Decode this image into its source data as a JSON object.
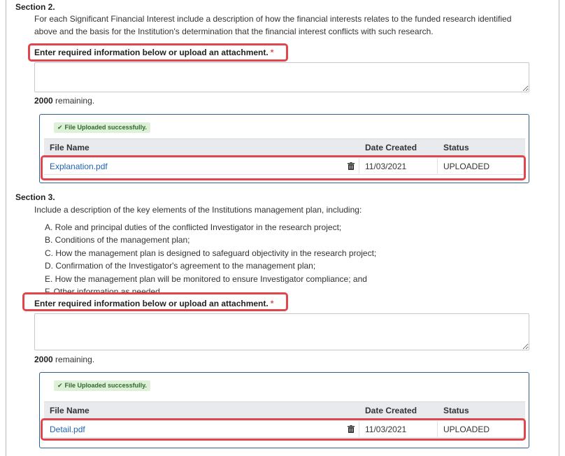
{
  "section2": {
    "title": "Section 2.",
    "description_line1": "For each Significant Financial Interest include a description of how the financial interests relates to the funded research identified",
    "description_line2": "above and the basis for the Institution's determination that the financial interest conflicts with such research.",
    "required_label": "Enter required information below or upload an attachment.",
    "required_marker": "*",
    "textarea_value": "",
    "remaining_count": "2000",
    "remaining_text": "remaining.",
    "upload_status": "File Uploaded successfully.",
    "table": {
      "headers": [
        "File Name",
        "Date Created",
        "Status"
      ],
      "rows": [
        {
          "file_name": "Explanation.pdf",
          "date_created": "11/03/2021",
          "status": "UPLOADED"
        }
      ]
    }
  },
  "section3": {
    "title": "Section 3.",
    "description": "Include a description of the key elements of the Institutions management plan, including:",
    "items": [
      "A. Role and principal duties of the conflicted Investigator in the research project;",
      "B. Conditions of the management plan;",
      "C. How the management plan is designed to safeguard objectivity in the research project;",
      "D. Confirmation of the Investigator's agreement to the management plan;",
      "E. How the management plan will be monitored to ensure Investigator compliance; and",
      "F. Other information as needed."
    ],
    "required_label": "Enter required information below or upload an attachment.",
    "required_marker": "*",
    "textarea_value": "",
    "remaining_count": "2000",
    "remaining_text": "remaining.",
    "upload_status": "File Uploaded successfully.",
    "table": {
      "headers": [
        "File Name",
        "Date Created",
        "Status"
      ],
      "rows": [
        {
          "file_name": "Detail.pdf",
          "date_created": "11/03/2021",
          "status": "UPLOADED"
        }
      ]
    }
  },
  "icons": {
    "check": "check-icon",
    "delete": "trash-icon"
  },
  "colors": {
    "highlight": "#e0464b",
    "link": "#1f63b6",
    "success_bg": "#dff0d8",
    "panel_border": "#2f5f8f",
    "required_star": "#d9534f"
  }
}
